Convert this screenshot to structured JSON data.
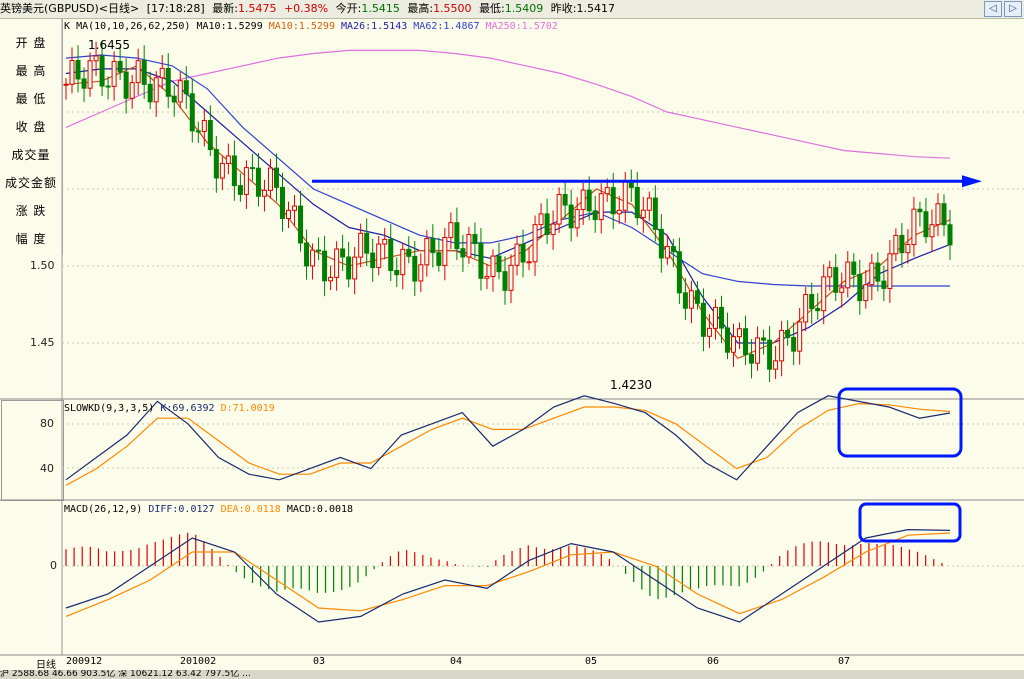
{
  "header": {
    "instrument": "英镑美元(GBPUSD)<日线>",
    "time": "[17:18:28]",
    "latest_label": "最新:",
    "latest_value": "1.5475",
    "change": "+0.38%",
    "open_label": "今开:",
    "open_value": "1.5415",
    "high_label": "最高:",
    "high_value": "1.5500",
    "low_label": "最低:",
    "low_value": "1.5409",
    "prev_close_label": "昨收:",
    "prev_close_value": "1.5417"
  },
  "nav_buttons": [
    "◁",
    "▷"
  ],
  "left_panel": [
    "开 盘",
    "最 高",
    "最 低",
    "收 盘",
    "成交量",
    "成交金额",
    "涨 跌",
    "幅 度"
  ],
  "main_chart": {
    "k_label": "K",
    "ma_label": "MA(10,10,26,62,250)",
    "ma10a": "MA10:1.5299",
    "ma10b": "MA10:1.5299",
    "ma26": "MA26:1.5143",
    "ma62": "MA62:1.4867",
    "ma250": "MA250:1.5702",
    "high_annot": "1.6455",
    "low_annot": "1.4230",
    "y_labels": [
      "1.50",
      "1.45"
    ]
  },
  "kd_chart": {
    "label": "SLOWKD(9,3,3,5)",
    "k_value": "K:69.6392",
    "d_value": "D:71.0019",
    "y_labels": [
      "80",
      "40"
    ]
  },
  "macd_chart": {
    "label": "MACD(26,12,9)",
    "diff_value": "DIFF:0.0127",
    "dea_value": "DEA:0.0118",
    "macd_value": "MACD:0.0018",
    "zero_label": "0"
  },
  "x_axis": {
    "period_label": "日线",
    "labels": [
      "200912",
      "201002",
      "03",
      "04",
      "05",
      "06",
      "07"
    ]
  },
  "status_bar": "沪 2588.68 46.66 903.5亿 深 10621.12 63.42 797.5亿 ...",
  "colors": {
    "up": "#e00000",
    "down": "#008000",
    "ma10": "#c8501e",
    "ma26": "#1c1ca8",
    "ma62": "#3040d0",
    "ma250": "#e070e0",
    "kd_k": "#1a2a70",
    "kd_d": "#ff8800",
    "annotation": "#0018ff"
  },
  "chart_data": [
    {
      "type": "candlestick",
      "title": "英镑美元(GBPUSD)<日线>",
      "x": [
        "200912",
        "201002",
        "03",
        "04",
        "05",
        "06",
        "07"
      ],
      "ylim": [
        1.41,
        1.66
      ],
      "high_marker": 1.6455,
      "low_marker": 1.423,
      "series": [
        {
          "name": "MA10",
          "values": [
            1.618,
            1.62,
            1.63,
            1.61,
            1.58,
            1.56,
            1.54,
            1.51,
            1.5,
            1.505,
            1.51,
            1.51,
            1.5,
            1.51,
            1.53,
            1.55,
            1.54,
            1.51,
            1.47,
            1.44,
            1.45,
            1.47,
            1.49,
            1.5,
            1.52,
            1.53
          ]
        },
        {
          "name": "MA26",
          "values": [
            1.625,
            1.628,
            1.628,
            1.62,
            1.6,
            1.58,
            1.56,
            1.54,
            1.525,
            1.52,
            1.51,
            1.51,
            1.505,
            1.515,
            1.525,
            1.535,
            1.535,
            1.52,
            1.48,
            1.45,
            1.45,
            1.46,
            1.475,
            1.495,
            1.505,
            1.514
          ]
        },
        {
          "name": "MA62",
          "values": [
            1.635,
            1.637,
            1.635,
            1.63,
            1.615,
            1.59,
            1.57,
            1.55,
            1.54,
            1.53,
            1.52,
            1.515,
            1.515,
            1.52,
            1.53,
            1.535,
            1.525,
            1.51,
            1.495,
            1.49,
            1.488,
            1.487,
            1.487,
            1.487,
            1.487,
            1.487
          ]
        },
        {
          "name": "MA250",
          "values": [
            1.59,
            1.6,
            1.61,
            1.62,
            1.625,
            1.63,
            1.635,
            1.638,
            1.64,
            1.64,
            1.64,
            1.638,
            1.635,
            1.63,
            1.625,
            1.618,
            1.61,
            1.6,
            1.595,
            1.59,
            1.585,
            1.58,
            1.575,
            1.573,
            1.571,
            1.57
          ]
        }
      ],
      "annotation": {
        "type": "horizontal-arrow",
        "y": 1.555
      }
    },
    {
      "type": "line",
      "title": "SLOWKD(9,3,3,5)",
      "ylim": [
        0,
        100
      ],
      "series": [
        {
          "name": "K",
          "values": [
            10,
            30,
            50,
            80,
            60,
            30,
            15,
            10,
            20,
            30,
            20,
            50,
            60,
            70,
            40,
            55,
            75,
            85,
            78,
            70,
            50,
            25,
            10,
            40,
            70,
            85,
            80,
            75,
            65,
            69.6
          ]
        },
        {
          "name": "D",
          "values": [
            5,
            20,
            40,
            65,
            65,
            45,
            25,
            15,
            15,
            25,
            25,
            40,
            55,
            65,
            55,
            55,
            65,
            75,
            75,
            72,
            60,
            40,
            20,
            30,
            55,
            72,
            78,
            77,
            73,
            71.0
          ]
        }
      ]
    },
    {
      "type": "bar",
      "title": "MACD(26,12,9)",
      "series": [
        {
          "name": "DIFF",
          "values": [
            -0.015,
            -0.01,
            0.0,
            0.01,
            0.005,
            -0.01,
            -0.02,
            -0.018,
            -0.01,
            -0.005,
            -0.008,
            0.002,
            0.008,
            0.005,
            -0.005,
            -0.015,
            -0.02,
            -0.01,
            0.0,
            0.01,
            0.013,
            0.0127
          ]
        },
        {
          "name": "DEA",
          "values": [
            -0.018,
            -0.012,
            -0.005,
            0.005,
            0.005,
            -0.005,
            -0.015,
            -0.016,
            -0.012,
            -0.007,
            -0.007,
            -0.002,
            0.004,
            0.005,
            0.0,
            -0.01,
            -0.017,
            -0.012,
            -0.004,
            0.005,
            0.011,
            0.0118
          ]
        }
      ]
    }
  ]
}
